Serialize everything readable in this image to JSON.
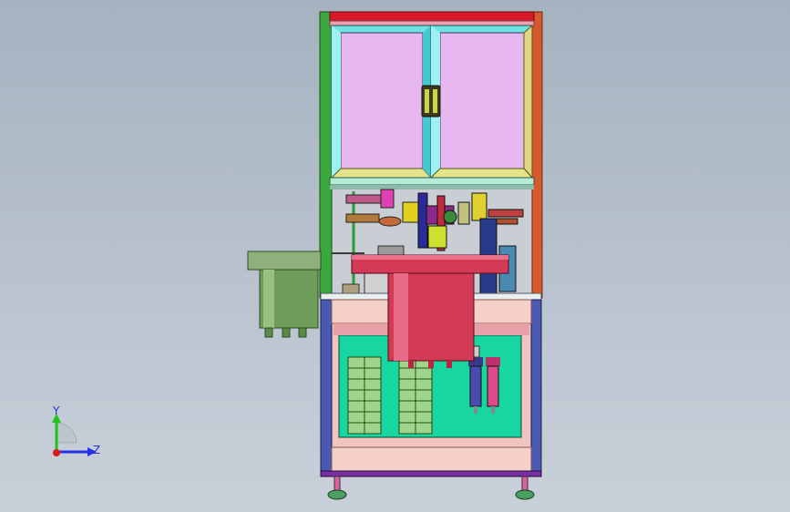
{
  "viewport": {
    "background_top": "#a6b2c0",
    "background_bottom": "#c9d0d9"
  },
  "triad": {
    "y_label": "Y",
    "z_label": "Z",
    "y_color": "#21c21a",
    "z_color": "#2330e8",
    "x_color": "#e01818"
  },
  "model": {
    "frame_color": "#3aa83c",
    "door_color": "#6ee3e6",
    "top_bar_color": "#d8192a",
    "turntable_color": "#d23a55",
    "feeder_color": "#6e9d5a",
    "cabinet_panel_color": "#17d6a0",
    "terminal_color": "#9fd58a",
    "foot_color": "#e060a0"
  }
}
